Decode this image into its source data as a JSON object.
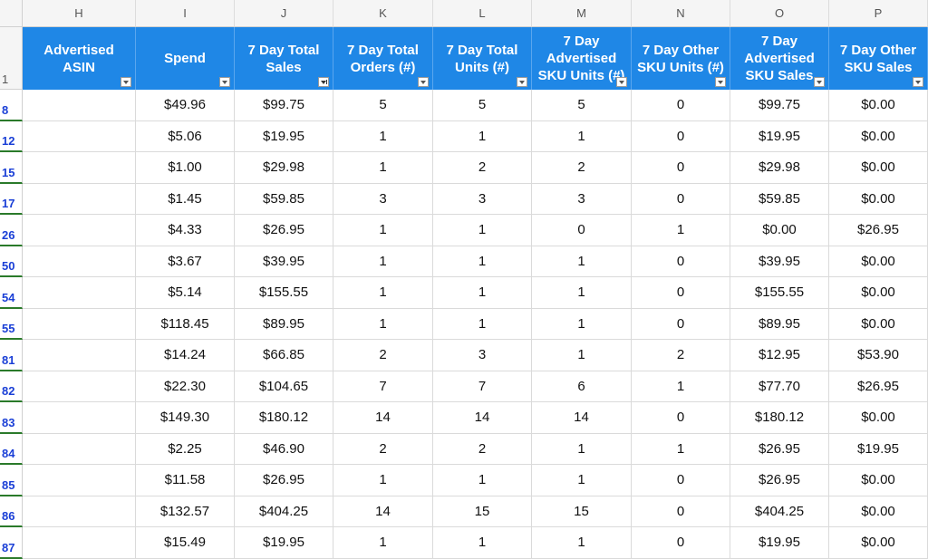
{
  "columns": [
    "H",
    "I",
    "J",
    "K",
    "L",
    "M",
    "N",
    "O",
    "P"
  ],
  "header_row_number": "1",
  "headers": [
    {
      "label": "Advertised ASIN"
    },
    {
      "label": "Spend"
    },
    {
      "label": "7 Day Total Sales"
    },
    {
      "label": "7 Day Total Orders (#)"
    },
    {
      "label": "7 Day Total Units (#)"
    },
    {
      "label": "7 Day Advertised SKU Units (#)"
    },
    {
      "label": "7 Day Other SKU Units (#)"
    },
    {
      "label": "7 Day Advertised SKU Sales"
    },
    {
      "label": "7 Day Other SKU Sales"
    }
  ],
  "rows": [
    {
      "num": "8",
      "cells": [
        "",
        "$49.96",
        "$99.75",
        "5",
        "5",
        "5",
        "0",
        "$99.75",
        "$0.00"
      ]
    },
    {
      "num": "12",
      "cells": [
        "",
        "$5.06",
        "$19.95",
        "1",
        "1",
        "1",
        "0",
        "$19.95",
        "$0.00"
      ]
    },
    {
      "num": "15",
      "cells": [
        "",
        "$1.00",
        "$29.98",
        "1",
        "2",
        "2",
        "0",
        "$29.98",
        "$0.00"
      ]
    },
    {
      "num": "17",
      "cells": [
        "",
        "$1.45",
        "$59.85",
        "3",
        "3",
        "3",
        "0",
        "$59.85",
        "$0.00"
      ]
    },
    {
      "num": "26",
      "cells": [
        "",
        "$4.33",
        "$26.95",
        "1",
        "1",
        "0",
        "1",
        "$0.00",
        "$26.95"
      ]
    },
    {
      "num": "50",
      "cells": [
        "",
        "$3.67",
        "$39.95",
        "1",
        "1",
        "1",
        "0",
        "$39.95",
        "$0.00"
      ]
    },
    {
      "num": "54",
      "cells": [
        "",
        "$5.14",
        "$155.55",
        "1",
        "1",
        "1",
        "0",
        "$155.55",
        "$0.00"
      ]
    },
    {
      "num": "55",
      "cells": [
        "",
        "$118.45",
        "$89.95",
        "1",
        "1",
        "1",
        "0",
        "$89.95",
        "$0.00"
      ]
    },
    {
      "num": "81",
      "cells": [
        "",
        "$14.24",
        "$66.85",
        "2",
        "3",
        "1",
        "2",
        "$12.95",
        "$53.90"
      ]
    },
    {
      "num": "82",
      "cells": [
        "",
        "$22.30",
        "$104.65",
        "7",
        "7",
        "6",
        "1",
        "$77.70",
        "$26.95"
      ]
    },
    {
      "num": "83",
      "cells": [
        "",
        "$149.30",
        "$180.12",
        "14",
        "14",
        "14",
        "0",
        "$180.12",
        "$0.00"
      ]
    },
    {
      "num": "84",
      "cells": [
        "",
        "$2.25",
        "$46.90",
        "2",
        "2",
        "1",
        "1",
        "$26.95",
        "$19.95"
      ]
    },
    {
      "num": "85",
      "cells": [
        "",
        "$11.58",
        "$26.95",
        "1",
        "1",
        "1",
        "0",
        "$26.95",
        "$0.00"
      ]
    },
    {
      "num": "86",
      "cells": [
        "",
        "$132.57",
        "$404.25",
        "14",
        "15",
        "15",
        "0",
        "$404.25",
        "$0.00"
      ]
    },
    {
      "num": "87",
      "cells": [
        "",
        "$15.49",
        "$19.95",
        "1",
        "1",
        "1",
        "0",
        "$19.95",
        "$0.00"
      ]
    }
  ],
  "filter_active_column": "J",
  "colors": {
    "header_bg": "#1f87e6",
    "row_number_text": "#1a3fd6",
    "filtered_row_marker": "#2a7a2a"
  },
  "icons": {
    "dropdown": "dropdown-arrow-icon",
    "filter": "filter-icon"
  }
}
